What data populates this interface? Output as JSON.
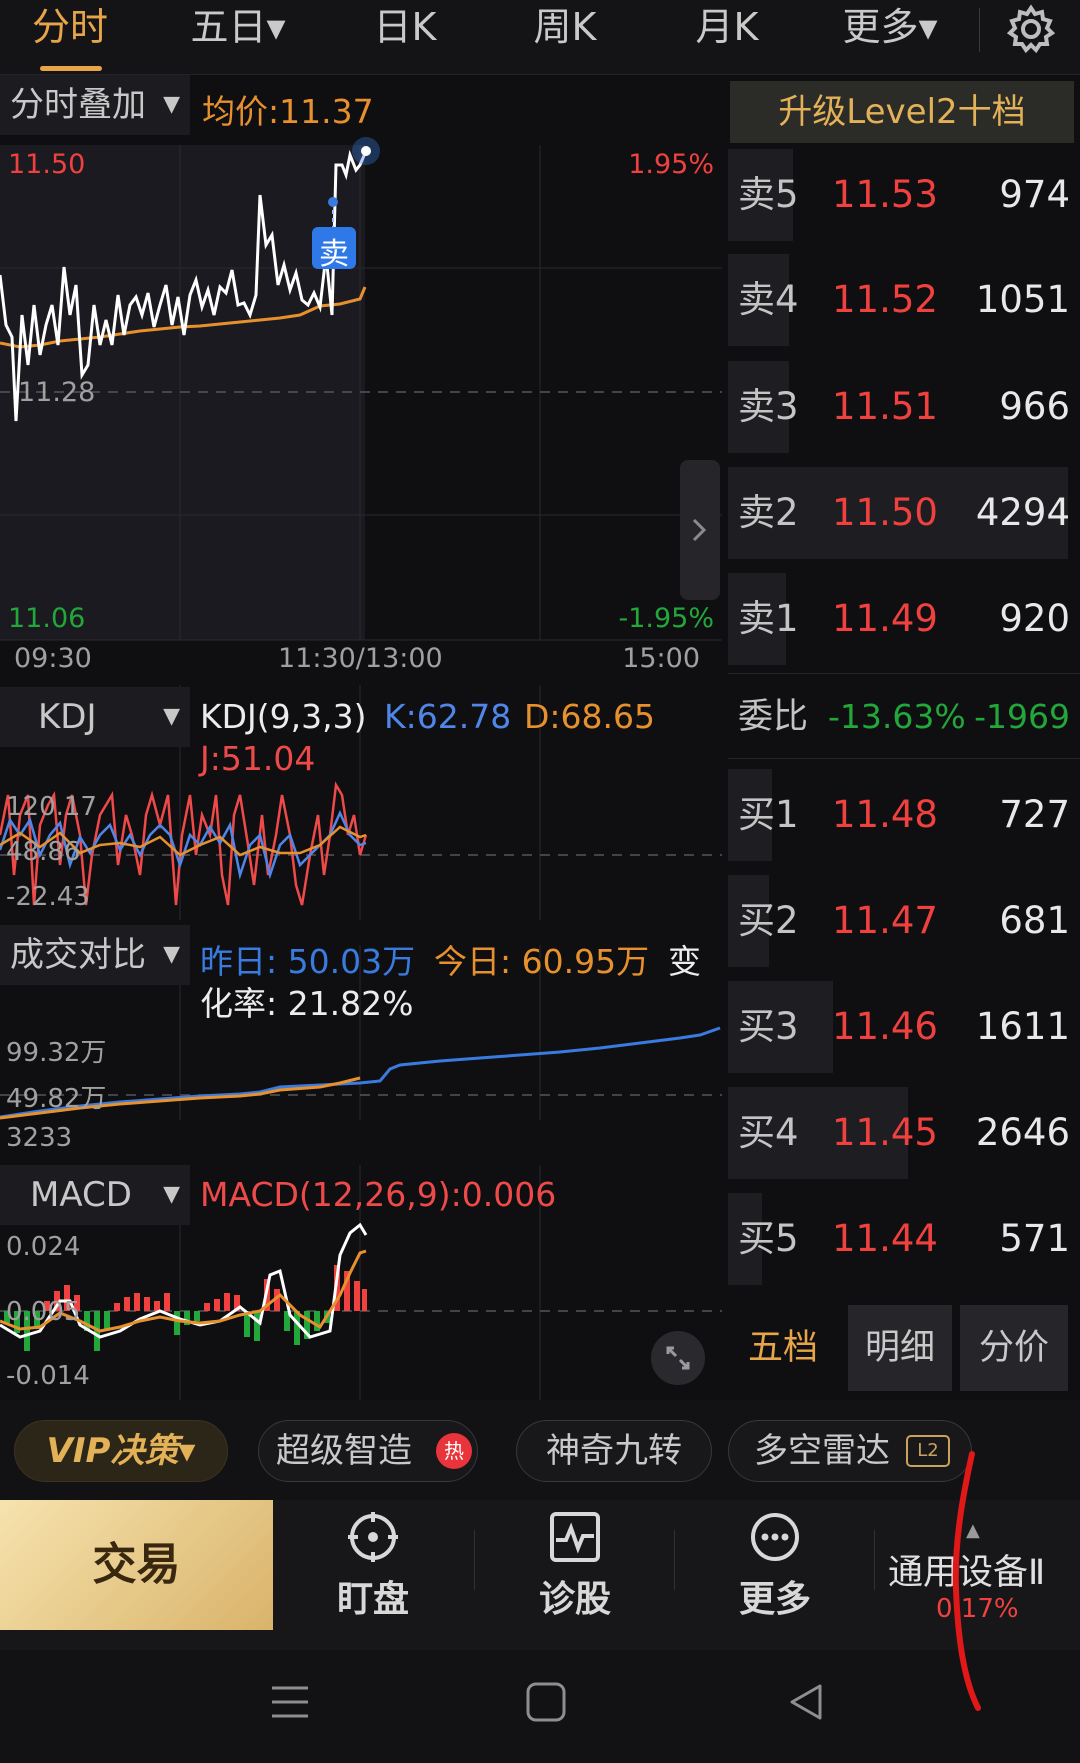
{
  "tabs": [
    {
      "label": "分时",
      "active": true
    },
    {
      "label": "五日▾",
      "active": false
    },
    {
      "label": "日K",
      "active": false
    },
    {
      "label": "周K",
      "active": false
    },
    {
      "label": "月K",
      "active": false
    },
    {
      "label": "更多▾",
      "active": false
    }
  ],
  "settings_icon": "gear-icon",
  "intraday": {
    "overlay_dropdown": "分时叠加",
    "avg_price": "均价:11.37",
    "price_high": "11.50",
    "price_mid": "11.28",
    "price_low": "11.06",
    "pct_high": "1.95%",
    "pct_low": "-1.95%",
    "time_start": "09:30",
    "time_mid": "11:30/13:00",
    "time_end": "15:00",
    "sell_marker": "卖"
  },
  "kdj": {
    "dropdown": "KDJ",
    "params": "KDJ(9,3,3)",
    "k": "K:62.78",
    "d": "D:68.65",
    "j": "J:51.04",
    "axis_top": "120.17",
    "axis_mid": "48.86",
    "axis_bottom": "-22.43"
  },
  "volume_compare": {
    "dropdown": "成交对比",
    "yesterday": "昨日: 50.03万",
    "today": "今日: 60.95万",
    "change_prefix": "变",
    "change_rest": "化率: 21.82%",
    "axis_top": "99.32万",
    "axis_mid": "49.82万",
    "axis_bottom": "3233"
  },
  "macd": {
    "dropdown": "MACD",
    "params": "MACD(12,26,9):0.006",
    "axis_top": "0.024",
    "axis_mid": "0.005",
    "axis_bottom": "-0.014"
  },
  "order_book": {
    "upgrade": "升级Level2十档",
    "asks": [
      {
        "label": "卖5",
        "price": "11.53",
        "volume": "974",
        "bar": 0.19
      },
      {
        "label": "卖4",
        "price": "11.52",
        "volume": "1051",
        "bar": 0.18
      },
      {
        "label": "卖3",
        "price": "11.51",
        "volume": "966",
        "bar": 0.18
      },
      {
        "label": "卖2",
        "price": "11.50",
        "volume": "4294",
        "bar": 1.0
      },
      {
        "label": "卖1",
        "price": "11.49",
        "volume": "920",
        "bar": 0.17
      }
    ],
    "ratio_label": "委比",
    "ratio_pct": "-13.63%",
    "ratio_val": "-1969",
    "bids": [
      {
        "label": "买1",
        "price": "11.48",
        "volume": "727",
        "bar": 0.13
      },
      {
        "label": "买2",
        "price": "11.47",
        "volume": "681",
        "bar": 0.12
      },
      {
        "label": "买3",
        "price": "11.46",
        "volume": "1611",
        "bar": 0.31
      },
      {
        "label": "买4",
        "price": "11.45",
        "volume": "2646",
        "bar": 0.53
      },
      {
        "label": "买5",
        "price": "11.44",
        "volume": "571",
        "bar": 0.1
      }
    ],
    "tabs": [
      "五档",
      "明细",
      "分价"
    ]
  },
  "features": {
    "vip": "VIP决策▾",
    "smart": "超级智造",
    "hot": "热",
    "nine": "神奇九转",
    "radar": "多空雷达",
    "l2": "L2"
  },
  "toolbar": {
    "trade": "交易",
    "watch": "盯盘",
    "diagnose": "诊股",
    "more": "更多",
    "sector_name": "通用设备Ⅱ",
    "sector_pct": "0.17%"
  },
  "colors": {
    "accent": "#e7a448",
    "up_red": "#f0413f",
    "down_green": "#22a83a",
    "blue": "#3a7be0"
  }
}
